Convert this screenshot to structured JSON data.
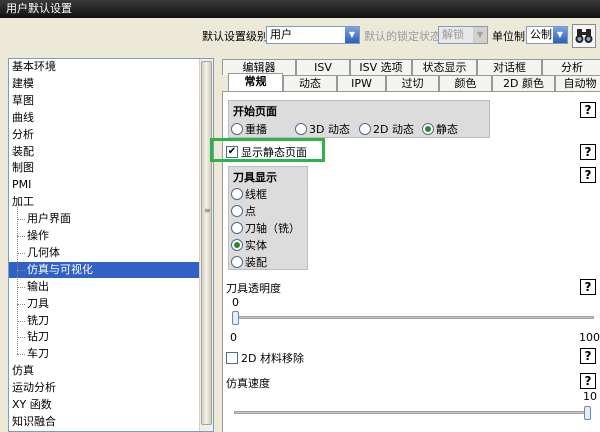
{
  "window": {
    "title": "用户默认设置"
  },
  "toolbar": {
    "level_label": "默认设置级别",
    "level_value": "用户",
    "lock_label": "默认的锁定状态",
    "lock_value": "解锁",
    "unit_label": "单位制",
    "unit_value": "公制",
    "find_icon": "binoculars-icon"
  },
  "tree": {
    "items": [
      {
        "label": "基本环境",
        "level": 0
      },
      {
        "label": "建模",
        "level": 0
      },
      {
        "label": "草图",
        "level": 0
      },
      {
        "label": "曲线",
        "level": 0
      },
      {
        "label": "分析",
        "level": 0
      },
      {
        "label": "装配",
        "level": 0
      },
      {
        "label": "制图",
        "level": 0
      },
      {
        "label": "PMI",
        "level": 0
      },
      {
        "label": "加工",
        "level": 0
      },
      {
        "label": "用户界面",
        "level": 1
      },
      {
        "label": "操作",
        "level": 1
      },
      {
        "label": "几何体",
        "level": 1
      },
      {
        "label": "仿真与可视化",
        "level": 1,
        "selected": true
      },
      {
        "label": "输出",
        "level": 1
      },
      {
        "label": "刀具",
        "level": 1
      },
      {
        "label": "铣刀",
        "level": 1
      },
      {
        "label": "钻刀",
        "level": 1
      },
      {
        "label": "车刀",
        "level": 1
      },
      {
        "label": "仿真",
        "level": 0
      },
      {
        "label": "运动分析",
        "level": 0
      },
      {
        "label": "XY 函数",
        "level": 0
      },
      {
        "label": "知识融合",
        "level": 0
      }
    ]
  },
  "tabs": {
    "row1": [
      "编辑器",
      "ISV",
      "ISV 选项",
      "状态显示",
      "对话框",
      "分析"
    ],
    "row2": [
      "常规",
      "动态",
      "IPW",
      "过切",
      "颜色",
      "2D 颜色",
      "自动物"
    ],
    "active": "常规"
  },
  "settings": {
    "start_page": {
      "title": "开始页面",
      "options": [
        "重播",
        "3D 动态",
        "2D 动态",
        "静态"
      ],
      "selected": "静态"
    },
    "show_static_page": {
      "label": "显示静态页面",
      "checked": true
    },
    "tool_display": {
      "title": "刀具显示",
      "options": [
        "线框",
        "点",
        "刀轴（铣）",
        "实体",
        "装配"
      ],
      "selected": "实体"
    },
    "tool_transparency": {
      "label": "刀具透明度",
      "value": "0",
      "min": "0",
      "max": "100",
      "fraction": 0
    },
    "material_removal_2d": {
      "label": "2D 材料移除",
      "checked": false
    },
    "sim_speed": {
      "label": "仿真速度",
      "value": "10",
      "fraction": 1
    },
    "help_glyph": "?"
  }
}
